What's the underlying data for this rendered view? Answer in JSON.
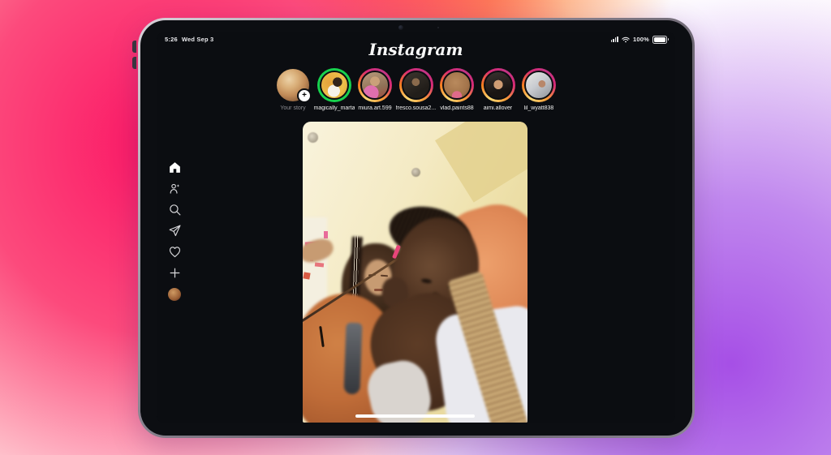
{
  "status_bar": {
    "time": "5:26",
    "date": "Wed Sep 3",
    "battery_percent": "100%",
    "icons": [
      "signal-icon",
      "wifi-icon",
      "battery-icon"
    ]
  },
  "header": {
    "logo_text": "Instagram"
  },
  "stories": {
    "items": [
      {
        "username": "Your story",
        "own": true,
        "ring": "none",
        "badge": "plus"
      },
      {
        "username": "magically_marta",
        "ring": "close-friends-green"
      },
      {
        "username": "miura.art.599",
        "ring": "gradient"
      },
      {
        "username": "fresco.sousa2...",
        "ring": "gradient"
      },
      {
        "username": "vlad.paints88",
        "ring": "gradient"
      },
      {
        "username": "aimi.allover",
        "ring": "gradient"
      },
      {
        "username": "lil_wyatt838",
        "ring": "gradient"
      }
    ]
  },
  "sidebar": {
    "items": [
      {
        "name": "home",
        "icon": "home-icon",
        "active": true
      },
      {
        "name": "discover-people",
        "icon": "people-icon"
      },
      {
        "name": "search",
        "icon": "search-icon"
      },
      {
        "name": "messages",
        "icon": "send-icon"
      },
      {
        "name": "notifications",
        "icon": "heart-icon"
      },
      {
        "name": "create",
        "icon": "plus-icon"
      },
      {
        "name": "profile",
        "icon": "profile-avatar"
      }
    ]
  },
  "feed": {
    "post_type": "photo",
    "home_indicator": true
  },
  "colors": {
    "screen_bg": "#0b0d11",
    "close_friends_ring": "#17d14e",
    "story_ring_gradient": [
      "#feda75",
      "#fa7e1e",
      "#d62976"
    ],
    "bg_pink": "#fb1464",
    "bg_orange": "#fd5126",
    "bg_purple": "#a64fe6",
    "your_story_label": "#8e8e93"
  }
}
